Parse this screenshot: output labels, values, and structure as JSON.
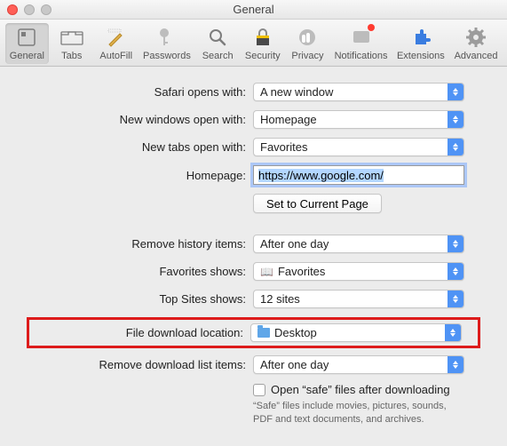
{
  "window": {
    "title": "General"
  },
  "toolbar": {
    "items": [
      {
        "key": "general",
        "label": "General"
      },
      {
        "key": "tabs",
        "label": "Tabs"
      },
      {
        "key": "autofill",
        "label": "AutoFill"
      },
      {
        "key": "passwords",
        "label": "Passwords"
      },
      {
        "key": "search",
        "label": "Search"
      },
      {
        "key": "security",
        "label": "Security"
      },
      {
        "key": "privacy",
        "label": "Privacy"
      },
      {
        "key": "notifications",
        "label": "Notifications"
      },
      {
        "key": "extensions",
        "label": "Extensions"
      },
      {
        "key": "advanced",
        "label": "Advanced"
      }
    ],
    "selected": "general"
  },
  "form": {
    "opens_with": {
      "label": "Safari opens with:",
      "value": "A new window"
    },
    "new_windows": {
      "label": "New windows open with:",
      "value": "Homepage"
    },
    "new_tabs": {
      "label": "New tabs open with:",
      "value": "Favorites"
    },
    "homepage": {
      "label": "Homepage:",
      "value": "https://www.google.com/"
    },
    "set_current": "Set to Current Page",
    "remove_history": {
      "label": "Remove history items:",
      "value": "After one day"
    },
    "favorites_shows": {
      "label": "Favorites shows:",
      "value": "Favorites"
    },
    "topsites": {
      "label": "Top Sites shows:",
      "value": "12 sites"
    },
    "download_loc": {
      "label": "File download location:",
      "value": "Desktop"
    },
    "remove_downloads": {
      "label": "Remove download list items:",
      "value": "After one day"
    },
    "safe_files": {
      "label": "Open “safe” files after downloading",
      "sub": "“Safe” files include movies, pictures, sounds, PDF and text documents, and archives."
    }
  }
}
